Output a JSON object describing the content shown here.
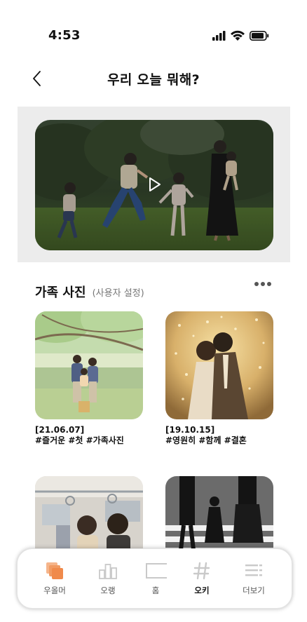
{
  "status_bar": {
    "time": "4:53"
  },
  "header": {
    "title": "우리 오늘 뭐해?"
  },
  "section": {
    "title": "가족 사진",
    "subtitle": "(사용자 설정)"
  },
  "photos": [
    {
      "date": "[21.06.07]",
      "tags": "#즐거운 #첫 #가족사진"
    },
    {
      "date": "[19.10.15]",
      "tags": "#영원히 #함께 #결혼"
    },
    {
      "date": "",
      "tags": ""
    },
    {
      "date": "",
      "tags": ""
    }
  ],
  "tabs": [
    {
      "label": "우올머",
      "icon": "photos-stack-icon",
      "color": "#f08a4b"
    },
    {
      "label": "오랭",
      "icon": "bar-chart-icon",
      "color": "#c9c9c9"
    },
    {
      "label": "홈",
      "icon": "home-screen-icon",
      "color": "#c9c9c9"
    },
    {
      "label": "오키",
      "icon": "hashtag-icon",
      "color": "#c9c9c9"
    },
    {
      "label": "더보기",
      "icon": "list-menu-icon",
      "color": "#c9c9c9"
    }
  ],
  "colors": {
    "accent": "#f08a4b",
    "video_bg": "#ececec",
    "inactive_icon": "#c9c9c9"
  }
}
